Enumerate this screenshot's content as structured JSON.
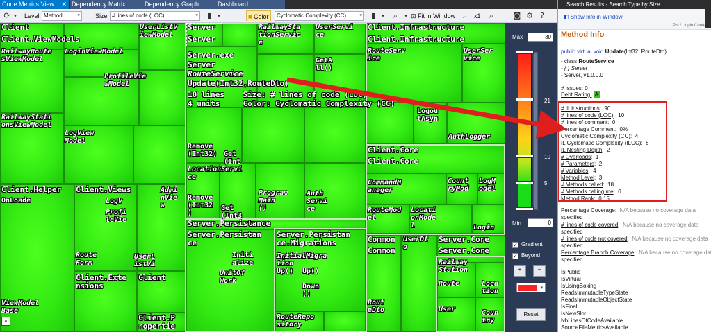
{
  "tabs": [
    {
      "label": "Code Metrics View",
      "close": "✕"
    },
    {
      "label": "Dependency Matrix"
    },
    {
      "label": "Dependency Graph"
    },
    {
      "label": "Dashboard"
    }
  ],
  "toolbar": {
    "level_label": "Level",
    "level_value": "Method",
    "size_label": "Size",
    "size_value": "# lines of code (LOC)",
    "color_label": "Color",
    "color_value": "Cyclomatic Complexity (CC)",
    "fit_label": "Fit in Window",
    "zoom_label": "x1",
    "icons": [
      "refresh-icon",
      "bar-chart-icon",
      "color-icon",
      "search-icon",
      "camera-icon",
      "gear-icon",
      "help-icon"
    ]
  },
  "treemap": {
    "labels": {
      "client": "Client",
      "client_viewmodels": "Client.ViewModels",
      "railwayroutes": "RailwayRoute\nsViewModel",
      "loginvm": "LoginViewModel",
      "userlistvm": "UserListV\niewModel",
      "profilevm": "ProfileVie\nwModel",
      "railwaystations": "RailwayStati\nonsViewModel",
      "logview": "LogView\nModel",
      "server1": "Server",
      "server2": "Server",
      "railwaystationservice": "RailwaySta\ntionServic\ne",
      "userservice": "UserServi\nce",
      "geta": "GetA\nll()",
      "server_exe": "Server.exe",
      "server_ns": "Server",
      "routeservice": "RouteService",
      "update_sig": "Update(Int32,RouteDto)",
      "info_lines": "10 lines    Size: # lines of code (LOC)",
      "info_units": "4 units     Color: Cyclomatic Complexity (CC)",
      "remove1": "Remove\n(Int32)",
      "get1": "Get\n(Int",
      "locationservi": "LocationServi\nce",
      "remove2": "Remove\n(Int32\n)",
      "get2": "Get\n(Int3",
      "program": "Program\nMain\n()",
      "authservice": "Auth\nServi\nce",
      "client_infra1": "Client.Infrastructure",
      "client_infra2": "Client.Infrastructure",
      "routeservice2": "RouteServ\nice",
      "userservice2": "UserSer\nvice",
      "logout": "Logou\ntAsyn",
      "authlogger": "AuthLogger",
      "client_core1": "Client.Core",
      "client_core2": "Client.Core",
      "commandmanager": "CommandM\nanager",
      "countrymodel": "Count\nryMod",
      "logmodel": "LogM\nodel",
      "routemodel": "RouteMod\nel",
      "locationmodel": "Locati\nonMode\nl",
      "login": "Login",
      "client_helper": "Client.Helper",
      "onloade": "OnLoade",
      "client_views": "Client.Views",
      "logv": "LogV",
      "profilevie": "Profi\nleVie",
      "adminview": "Admi\nnVie\nw",
      "routeform": "Route\nForm",
      "userlistvi": "UserL\nistVi",
      "client_extensions": "Client.Exte\nnsions",
      "client_short": "Client",
      "viewmodelbase": "ViewModel\nBase",
      "client_properties": "Client.P\nropertie",
      "server_persistance": "Server.Persistance",
      "server_persistan": "Server.Persistan\nce",
      "server_persistance_migrations": "Server.Persistan\nce.Migrations",
      "initialize": "Initi\nalize",
      "unitofwork": "UnitOf\nWork",
      "initialmigra": "InitialMigra\ntion",
      "up1": "Up()",
      "up2": "Up()",
      "down": "Down\n()",
      "routerepository": "RouteRepo\nsitory",
      "common1": "Common",
      "common2": "Common",
      "userdto": "UserDt\no",
      "routedto": "Rout\neDto",
      "server_core1": "Server.Core",
      "server_core2": "Server.Core",
      "railwaystation": "Railway\nStation",
      "route": "Route",
      "location": "Loca\ntion",
      "user": "User",
      "country": "Coun\ntry"
    }
  },
  "scale": {
    "max_label": "Max",
    "max_value": "30",
    "min_label": "Min",
    "min_value": "0",
    "tick_21": "21",
    "tick_10": "10",
    "tick_5": "5",
    "gradient_label": "Gradient",
    "beyond_label": "Beyond",
    "reset_label": "Reset",
    "selected_color": "#ff2020"
  },
  "search_pane": {
    "title": "Search Results - Search Type by Size",
    "show_info": "Show Info in Window",
    "pin": "Pin / Unpin Content",
    "heading": "Method Info",
    "signature_kw": "public virtual void",
    "signature_name": "Update",
    "signature_args": "(Int32, RouteDto)",
    "class_line_prefix": "- class",
    "class_name": "RouteService",
    "ns_line": "- { } Server",
    "asm_line": "- Server, v1.0.0.0",
    "issues": "# Issues:  0",
    "debt_label": "Debt Rating:",
    "debt_value": "A",
    "metrics": [
      {
        "k": "# IL instructions",
        "v": "90"
      },
      {
        "k": "# lines of code (LOC)",
        "v": "10"
      },
      {
        "k": "# lines of comment",
        "v": "0"
      },
      {
        "k": "Percentage Comment",
        "v": "0%"
      },
      {
        "k": "Cyclomatic Complexity (CC)",
        "v": "4"
      },
      {
        "k": "IL Cyclomatic Complexity (ILCC)",
        "v": "6"
      },
      {
        "k": "IL Nesting Depth",
        "v": "2"
      },
      {
        "k": "# Overloads",
        "v": "1"
      },
      {
        "k": "# Parameters",
        "v": "2"
      },
      {
        "k": "# Variables",
        "v": "4"
      },
      {
        "k": "Method Level",
        "v": "3"
      },
      {
        "k": "# Methods called",
        "v": "18"
      },
      {
        "k": "# Methods calling me",
        "v": "0"
      },
      {
        "k": "Method Rank",
        "v": "0.15"
      }
    ],
    "coverage": [
      {
        "k": "Percentage Coverage",
        "v": "N/A because no coverage data",
        "v2": "specified"
      },
      {
        "k": "# lines of code covered",
        "v": "N/A because no coverage data",
        "v2": "specified"
      },
      {
        "k": "# lines of code not covered",
        "v": "N/A because no coverage data",
        "v2": "specified"
      },
      {
        "k": "Percentage Branch Coverage",
        "v": "N/A because no coverage data",
        "v2": "specified"
      }
    ],
    "flags": [
      "IsPublic",
      "IsVirtual",
      "IsUsingBoxing",
      "ReadsImmutableTypeState",
      "ReadsImmutableObjectState",
      "IsFinal",
      "IsNewSlot",
      "NbLinesOfCodeAvailable",
      "SourceFileMetricsAvailable"
    ]
  },
  "colors": {
    "highlight_red": "#e01e1e",
    "accent_blue": "#007acc"
  }
}
